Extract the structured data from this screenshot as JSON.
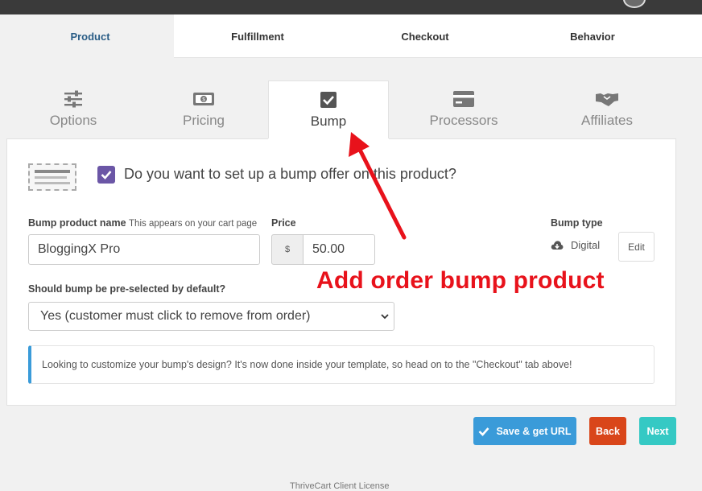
{
  "main_tabs": [
    {
      "label": "Product",
      "active": true
    },
    {
      "label": "Fulfillment",
      "active": false
    },
    {
      "label": "Checkout",
      "active": false
    },
    {
      "label": "Behavior",
      "active": false
    }
  ],
  "sub_tabs": [
    {
      "label": "Options",
      "icon": "sliders-icon",
      "active": false
    },
    {
      "label": "Pricing",
      "icon": "money-icon",
      "active": false
    },
    {
      "label": "Bump",
      "icon": "checkbox-icon",
      "active": true
    },
    {
      "label": "Processors",
      "icon": "credit-card-icon",
      "active": false
    },
    {
      "label": "Affiliates",
      "icon": "handshake-icon",
      "active": false
    }
  ],
  "bump": {
    "question": "Do you want to set up a bump offer on this product?",
    "checked": true,
    "name_label": "Bump product name",
    "name_hint": "This appears on your cart page",
    "name_value": "BloggingX Pro",
    "price_label": "Price",
    "currency": "$",
    "price_value": "50.00",
    "type_label": "Bump type",
    "type_value": "Digital",
    "edit_label": "Edit",
    "preselect_label": "Should bump be pre-selected by default?",
    "preselect_value": "Yes (customer must click to remove from order)",
    "info_text": "Looking to customize your bump's design? It's now done inside your template, so head on to the \"Checkout\" tab above!"
  },
  "annotation": "Add order bump product",
  "actions": {
    "save": "Save & get URL",
    "back": "Back",
    "next": "Next"
  },
  "footer": "ThriveCart Client License",
  "colors": {
    "accent_blue": "#3a9bd9",
    "checkbox_purple": "#6b56a6",
    "back_red": "#d9461a",
    "next_teal": "#35c9c4",
    "annotation_red": "#e8121b"
  }
}
